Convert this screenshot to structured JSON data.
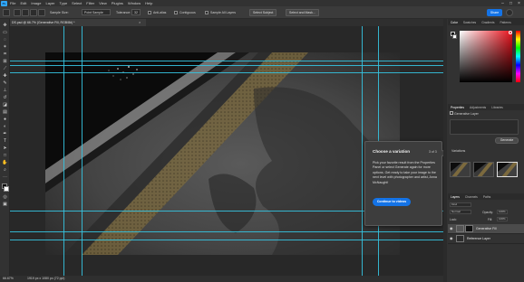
{
  "app": {
    "logo_text": "Ps"
  },
  "menubar": {
    "items": [
      "File",
      "Edit",
      "Image",
      "Layer",
      "Type",
      "Select",
      "Filter",
      "View",
      "Plugins",
      "Window",
      "Help"
    ],
    "controls": [
      "–",
      "□",
      "×"
    ]
  },
  "options_bar": {
    "sample_size_label": "Sample Size:",
    "sample_size_value": "Point Sample",
    "tolerance_label": "Tolerance:",
    "tolerance_value": "32",
    "anti_alias_label": "Anti-alias",
    "contiguous_label": "Contiguous",
    "sample_all_layers_label": "Sample All Layers",
    "select_subject_label": "Select Subject",
    "select_and_mask_label": "Select and Mask...",
    "share_label": "Share"
  },
  "document": {
    "tab_title": "DS.psd @ 66.7% (Generative Fill, RGB/8#) *",
    "close": "×"
  },
  "status_bar": {
    "zoom": "66.67%",
    "dimensions": "1919 px x 1080 px (72 ppi)"
  },
  "color_panel": {
    "tabs": [
      "Color",
      "Swatches",
      "Gradients",
      "Patterns"
    ],
    "fg_color": "#000000",
    "bg_color": "#ffffff"
  },
  "properties_panel": {
    "tabs": [
      "Properties",
      "Adjustments",
      "Libraries"
    ],
    "layer_type": "Generative Layer",
    "generate_label": "Generate",
    "variations_label": "Variations"
  },
  "layers_panel": {
    "tabs": [
      "Layers",
      "Channels",
      "Paths"
    ],
    "kind_label": "Kind",
    "blend_mode": "Normal",
    "opacity_label": "Opacity:",
    "opacity_value": "100%",
    "lock_label": "Lock:",
    "fill_label": "Fill:",
    "fill_value": "100%",
    "layers": [
      {
        "name": "Generative Fill",
        "selected": true
      },
      {
        "name": "Reference Layer",
        "selected": false
      }
    ]
  },
  "popup": {
    "title": "Choose a variation",
    "step": "3 of 3",
    "body": "Pick your favorite result from the Properties Panel or select Generate again for more options. Get ready to take your image to the next level with photographer and artist, Anna McNaught!",
    "button_label": "Continue to videos"
  },
  "colors": {
    "accent": "#1473e6",
    "guide": "#35c3e0",
    "panel_bg": "#323232",
    "canvas_bg": "#282828"
  }
}
